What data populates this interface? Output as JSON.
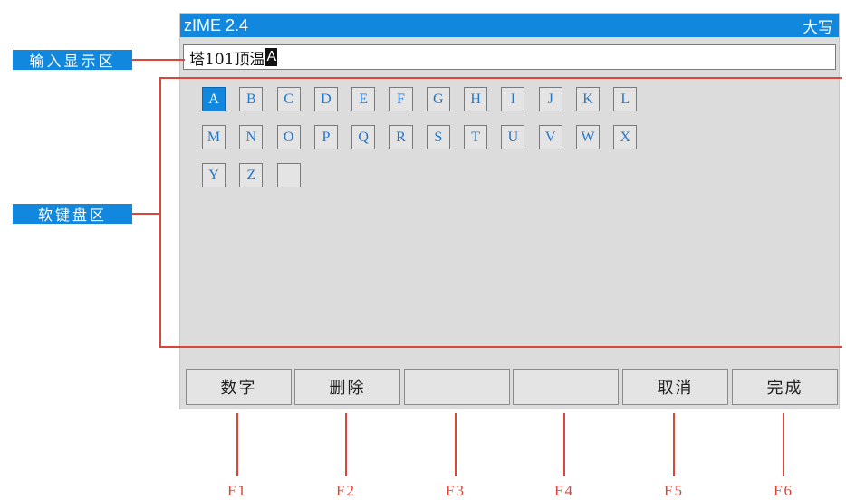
{
  "window": {
    "title": "zIME 2.4",
    "mode_indicator": "大写"
  },
  "input": {
    "value": "塔101顶温",
    "cursor_char": "A"
  },
  "keyboard": {
    "keys": [
      "A",
      "B",
      "C",
      "D",
      "E",
      "F",
      "G",
      "H",
      "I",
      "J",
      "K",
      "L",
      "M",
      "N",
      "O",
      "P",
      "Q",
      "R",
      "S",
      "T",
      "U",
      "V",
      "W",
      "X",
      "Y",
      "Z",
      ""
    ],
    "selected_key": "A"
  },
  "function_buttons": [
    {
      "label": "数字",
      "fkey": "F1"
    },
    {
      "label": "删除",
      "fkey": "F2"
    },
    {
      "label": "",
      "fkey": "F3"
    },
    {
      "label": "",
      "fkey": "F4"
    },
    {
      "label": "取消",
      "fkey": "F5"
    },
    {
      "label": "完成",
      "fkey": "F6"
    }
  ],
  "annotations": {
    "input_area": "输入显示区",
    "keyboard_area": "软键盘区"
  },
  "colors": {
    "accent": "#1188dd",
    "annotation": "#d9463a",
    "screen_bg": "#dcdcdc"
  }
}
